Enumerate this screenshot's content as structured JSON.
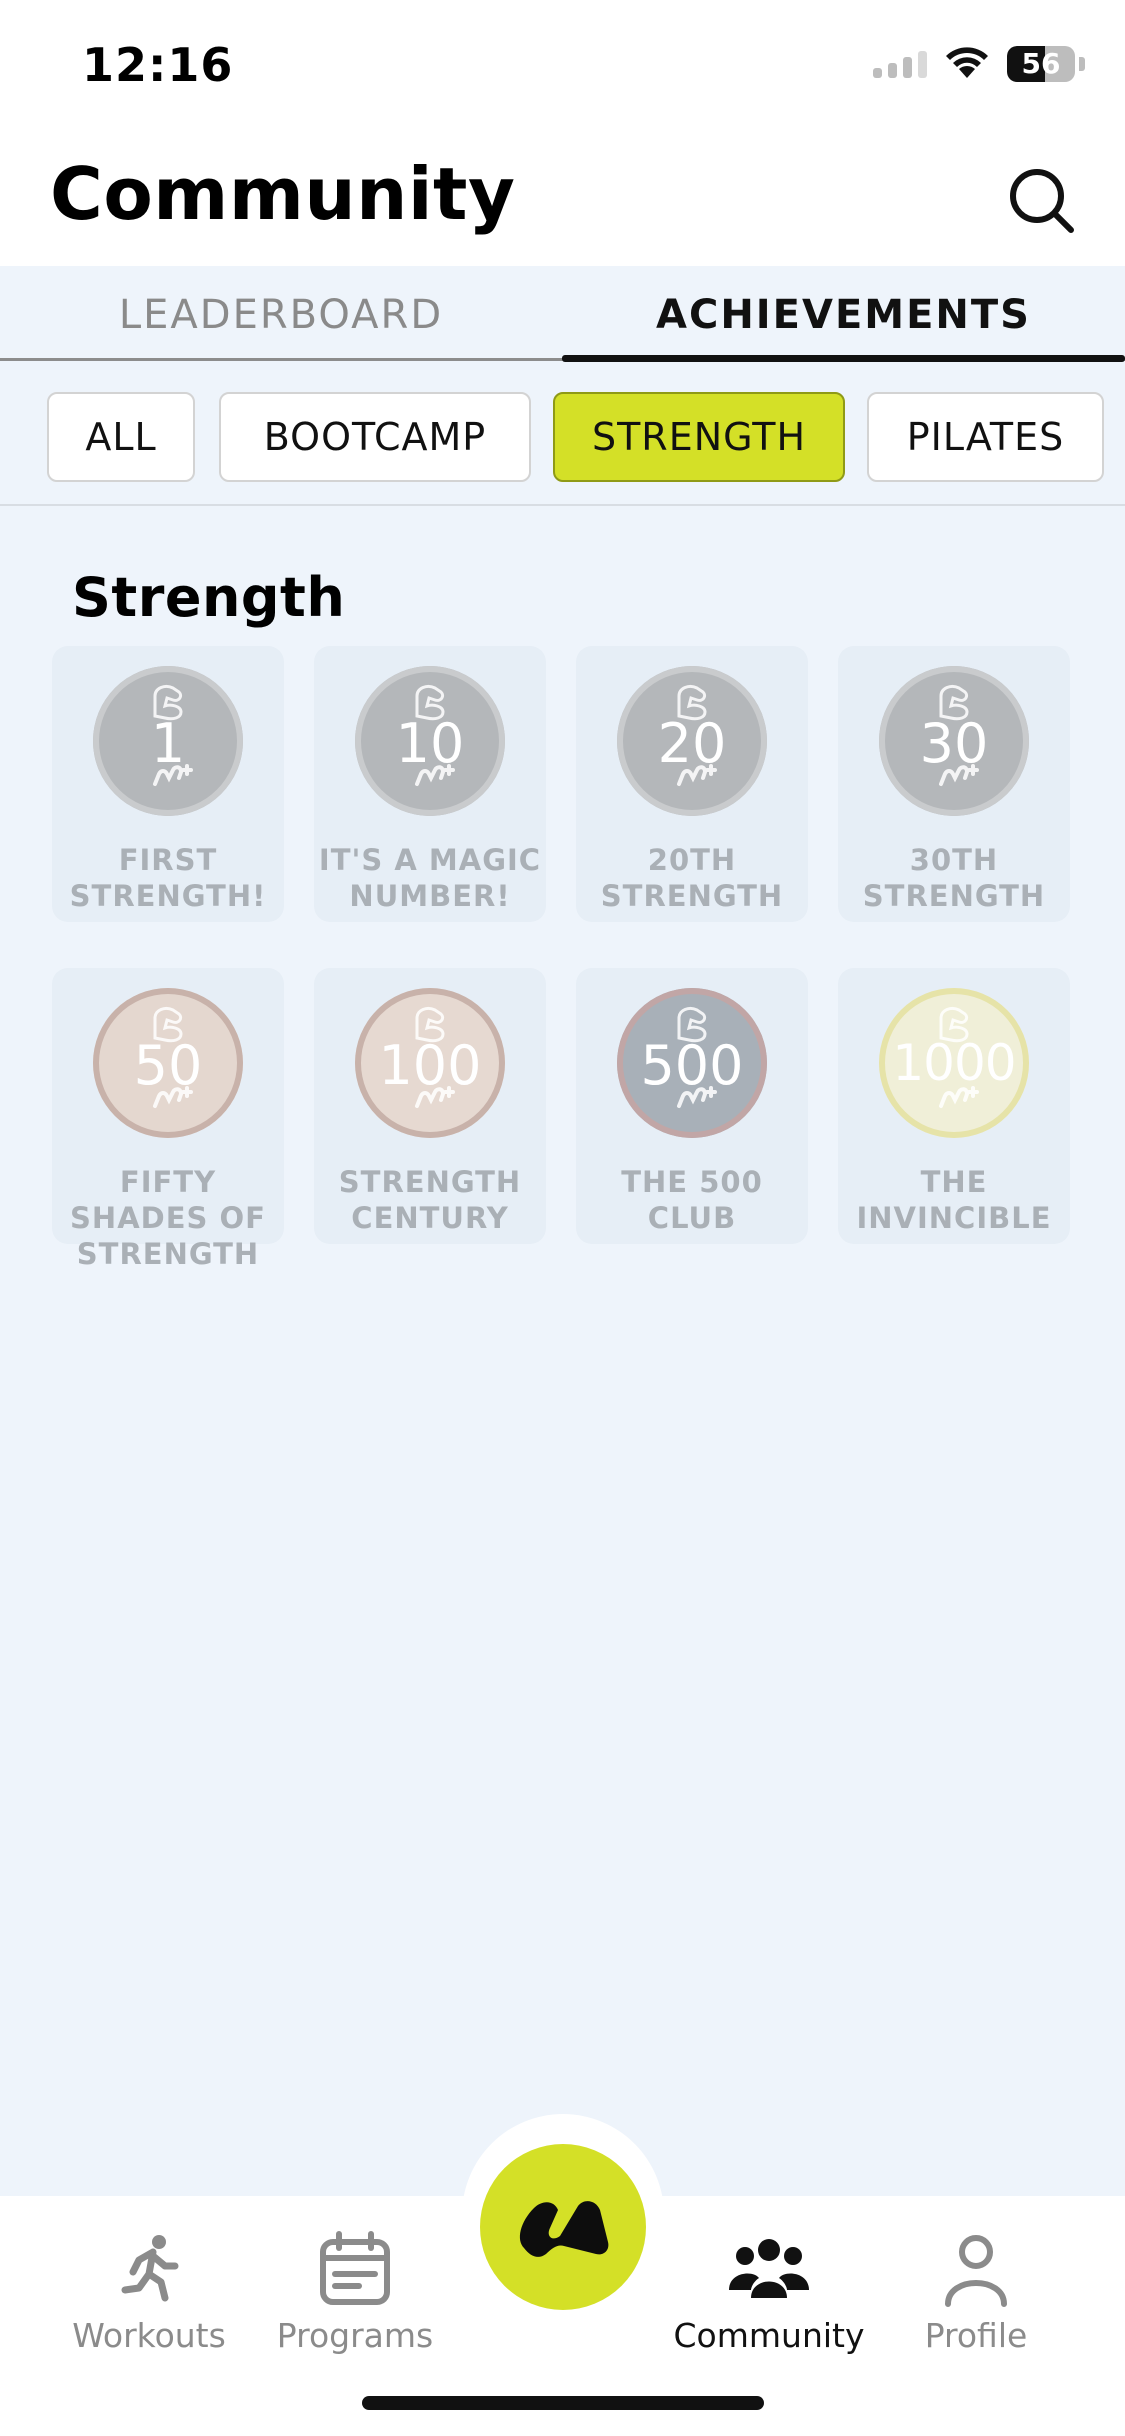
{
  "status": {
    "time": "12:16",
    "battery": "56",
    "battery_level": 0.56
  },
  "header": {
    "title": "Community",
    "search_icon": "search-icon"
  },
  "tabs": [
    {
      "label": "LEADERBOARD",
      "active": false
    },
    {
      "label": "ACHIEVEMENTS",
      "active": true
    }
  ],
  "filters": [
    {
      "label": "ALL",
      "active": false
    },
    {
      "label": "BOOTCAMP",
      "active": false
    },
    {
      "label": "STRENGTH",
      "active": true
    },
    {
      "label": "PILATES",
      "active": false
    }
  ],
  "section": {
    "title": "Strength"
  },
  "achievements": [
    {
      "number": "1",
      "label": "FIRST STRENGTH!",
      "medal_color": "#b4b7ba",
      "ring_color": "#c9cbcd"
    },
    {
      "number": "10",
      "label": "IT'S A MAGIC NUMBER!",
      "medal_color": "#b4b7ba",
      "ring_color": "#c9cbcd"
    },
    {
      "number": "20",
      "label": "20TH STRENGTH",
      "medal_color": "#b4b7ba",
      "ring_color": "#c9cbcd"
    },
    {
      "number": "30",
      "label": "30TH STRENGTH",
      "medal_color": "#b4b7ba",
      "ring_color": "#c9cbcd"
    },
    {
      "number": "50",
      "label": "FIFTY SHADES OF STRENGTH",
      "medal_color": "#e4d7cf",
      "ring_color": "#c8b2aa"
    },
    {
      "number": "100",
      "label": "STRENGTH CENTURY",
      "medal_color": "#e6d9d1",
      "ring_color": "#c8b2aa"
    },
    {
      "number": "500",
      "label": "THE 500 CLUB",
      "medal_color": "#a8b0b8",
      "ring_color": "#c1a6a6"
    },
    {
      "number": "1000",
      "label": "THE INVINCIBLE",
      "medal_color": "#f0efd8",
      "ring_color": "#e6e3a8"
    }
  ],
  "nav": {
    "workouts": "Workouts",
    "programs": "Programs",
    "community": "Community",
    "profile": "Profile",
    "center_color": "#d4e027"
  }
}
